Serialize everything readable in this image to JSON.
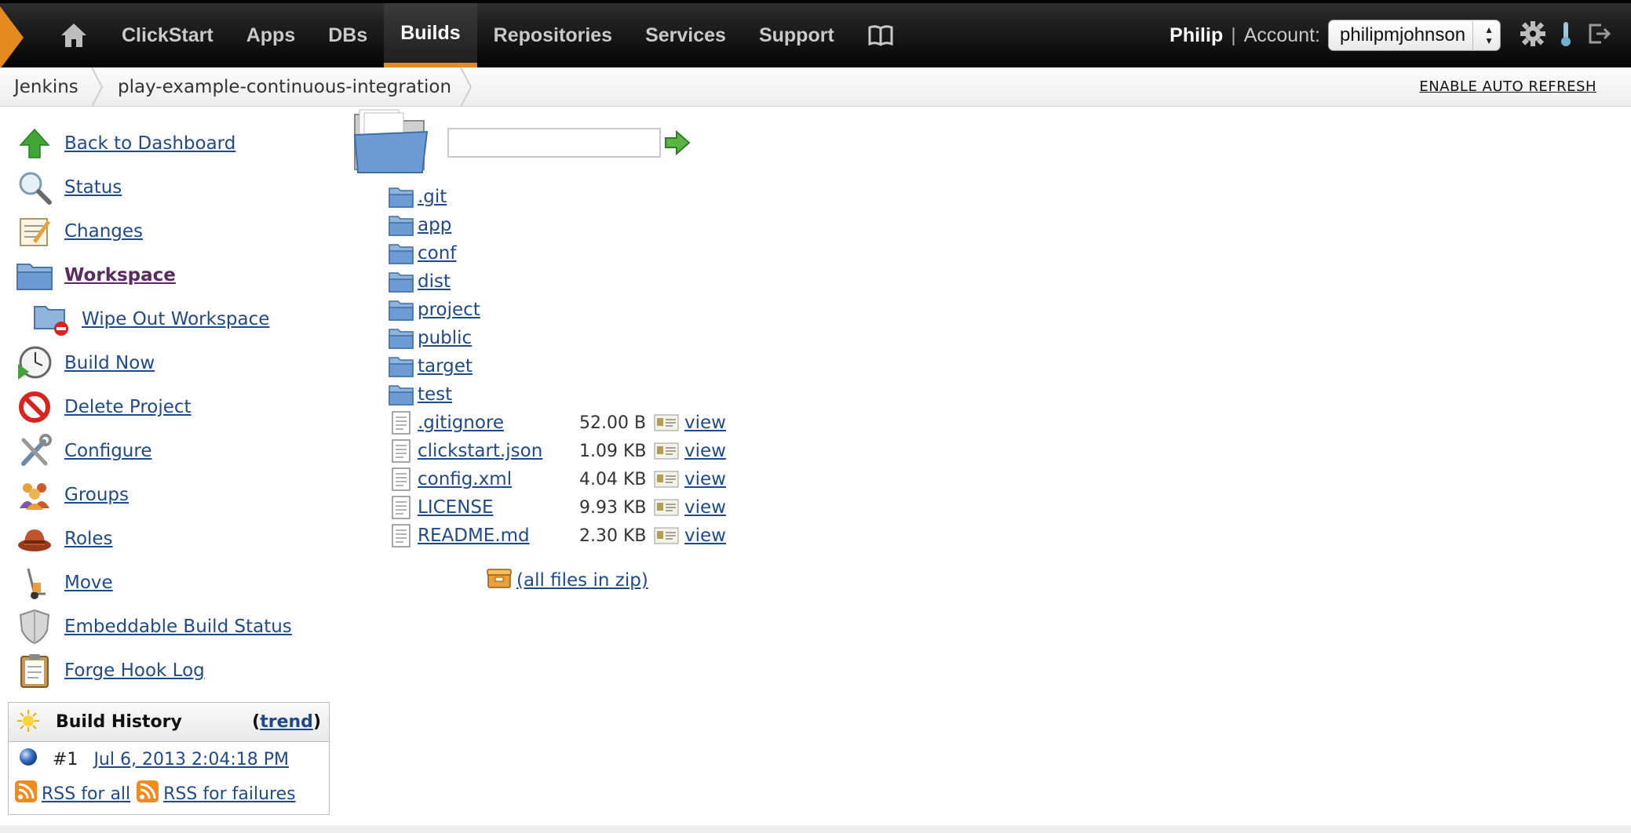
{
  "nav": {
    "items": [
      "ClickStart",
      "Apps",
      "DBs",
      "Builds",
      "Repositories",
      "Services",
      "Support"
    ],
    "active": "Builds",
    "user": "Philip",
    "separator": "|",
    "account_label": "Account:",
    "account_value": "philipmjohnson",
    "accent_color": "#e58a1f"
  },
  "breadcrumbs": [
    "Jenkins",
    "play-example-continuous-integration"
  ],
  "auto_refresh": "ENABLE AUTO REFRESH",
  "tasks": [
    {
      "label": "Back to Dashboard",
      "icon": "up-arrow-icon"
    },
    {
      "label": "Status",
      "icon": "magnifier-icon"
    },
    {
      "label": "Changes",
      "icon": "notepad-icon"
    },
    {
      "label": "Workspace",
      "icon": "folder-icon"
    },
    {
      "label": "Wipe Out Workspace",
      "icon": "folder-delete-icon"
    },
    {
      "label": "Build Now",
      "icon": "clock-play-icon"
    },
    {
      "label": "Delete Project",
      "icon": "no-entry-icon"
    },
    {
      "label": "Configure",
      "icon": "tools-icon"
    },
    {
      "label": "Groups",
      "icon": "people-icon"
    },
    {
      "label": "Roles",
      "icon": "hat-icon"
    },
    {
      "label": "Move",
      "icon": "hand-truck-icon"
    },
    {
      "label": "Embeddable Build Status",
      "icon": "shield-icon"
    },
    {
      "label": "Forge Hook Log",
      "icon": "clipboard-icon"
    }
  ],
  "build_history": {
    "title": "Build History",
    "trend_open": "(",
    "trend": "trend",
    "trend_close": ")",
    "builds": [
      {
        "number": "#1",
        "date": "Jul 6, 2013 2:04:18 PM"
      }
    ],
    "rss_all": "RSS for all",
    "rss_failures": "RSS for failures"
  },
  "workspace": {
    "path_value": "",
    "folders": [
      ".git",
      "app",
      "conf",
      "dist",
      "project",
      "public",
      "target",
      "test"
    ],
    "files": [
      {
        "name": ".gitignore",
        "size": "52.00 B",
        "view": "view"
      },
      {
        "name": "clickstart.json",
        "size": "1.09 KB",
        "view": "view"
      },
      {
        "name": "config.xml",
        "size": "4.04 KB",
        "view": "view"
      },
      {
        "name": "LICENSE",
        "size": "9.93 KB",
        "view": "view"
      },
      {
        "name": "README.md",
        "size": "2.30 KB",
        "view": "view"
      }
    ],
    "zip_label": "(all files in zip)"
  }
}
